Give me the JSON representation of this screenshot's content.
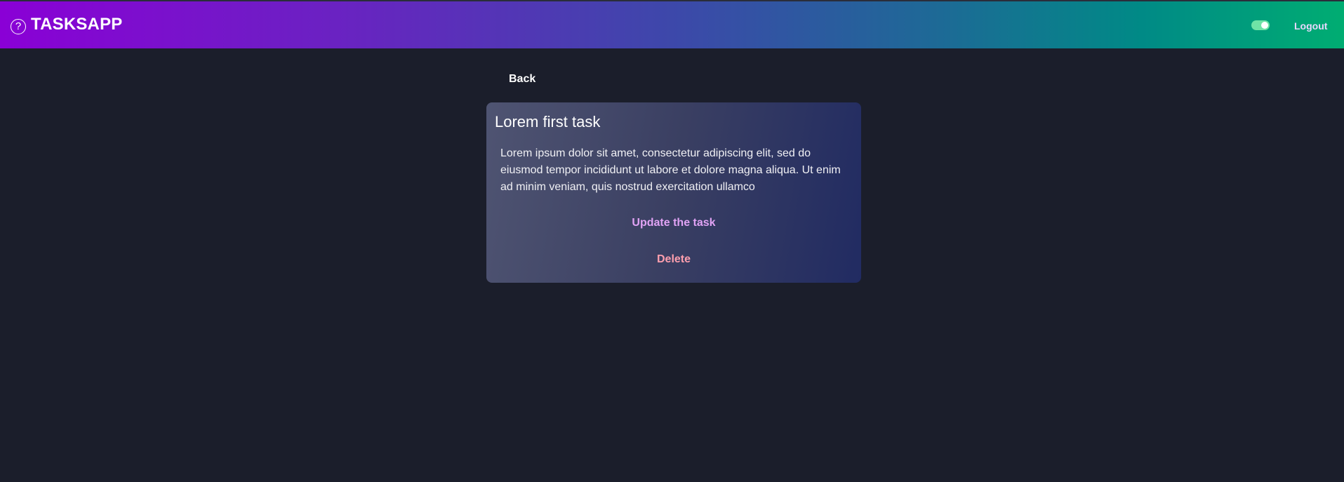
{
  "header": {
    "brand_icon": "help-circle-icon",
    "brand_icon_glyph": "?",
    "app_title": "TASKSAPP",
    "theme_toggle_on": true,
    "logout_label": "Logout"
  },
  "nav": {
    "back_label": "Back"
  },
  "task": {
    "title": "Lorem first task",
    "description": "Lorem ipsum dolor sit amet, consectetur adipiscing elit, sed do eiusmod tempor incididunt ut labore et dolore magna aliqua. Ut enim ad minim veniam, quis nostrud exercitation ullamco",
    "update_label": "Update the task",
    "delete_label": "Delete"
  },
  "colors": {
    "background": "#1b1e2b",
    "update_accent": "#e1a3f5",
    "delete_accent": "#ff9fae",
    "toggle_on": "#6fe3a6"
  }
}
